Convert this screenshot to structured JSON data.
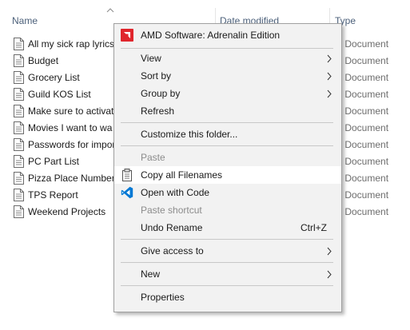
{
  "columns": {
    "name": "Name",
    "date": "Date modified",
    "type": "Type"
  },
  "files": [
    {
      "name": "All my sick rap lyrics",
      "type": "ext Document"
    },
    {
      "name": "Budget",
      "type": "ext Document"
    },
    {
      "name": "Grocery List",
      "type": "ext Document"
    },
    {
      "name": "Guild KOS List",
      "type": "ext Document"
    },
    {
      "name": "Make sure to activat",
      "type": "ext Document"
    },
    {
      "name": "Movies I want to wa",
      "type": "ext Document"
    },
    {
      "name": "Passwords for impor",
      "type": "ext Document"
    },
    {
      "name": "PC Part List",
      "type": "ext Document"
    },
    {
      "name": "Pizza Place Numbers",
      "type": "ext Document"
    },
    {
      "name": "TPS Report",
      "type": "ext Document"
    },
    {
      "name": "Weekend Projects",
      "type": "ext Document"
    }
  ],
  "menu": {
    "amd": "AMD Software: Adrenalin Edition",
    "view": "View",
    "sort_by": "Sort by",
    "group_by": "Group by",
    "refresh": "Refresh",
    "customize": "Customize this folder...",
    "paste": "Paste",
    "copy_filenames": "Copy all Filenames",
    "open_with_code": "Open with Code",
    "paste_shortcut": "Paste shortcut",
    "undo_rename": "Undo Rename",
    "undo_shortcut": "Ctrl+Z",
    "give_access": "Give access to",
    "new": "New",
    "properties": "Properties"
  },
  "colors": {
    "amd_red": "#e0262d",
    "vscode_blue": "#0078d4",
    "hover": "#ffffff"
  },
  "icons": {
    "amd": "amd-logo-icon",
    "clipboard": "clipboard-icon",
    "vscode": "vscode-icon",
    "file": "text-file-icon"
  }
}
